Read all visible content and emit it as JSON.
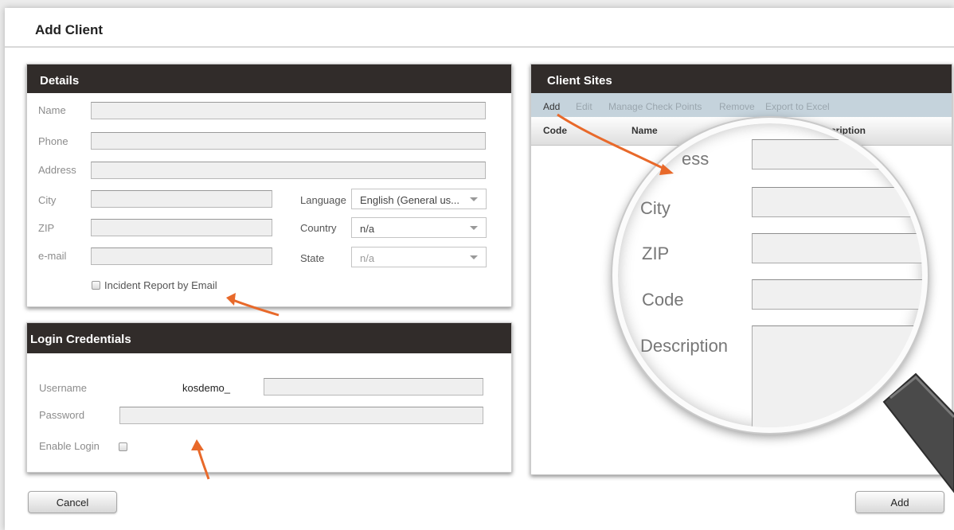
{
  "window": {
    "title": "Add Client"
  },
  "details": {
    "title": "Details",
    "fields": {
      "name": {
        "label": "Name",
        "value": ""
      },
      "phone": {
        "label": "Phone",
        "value": ""
      },
      "address": {
        "label": "Address",
        "value": ""
      },
      "city": {
        "label": "City",
        "value": ""
      },
      "zip": {
        "label": "ZIP",
        "value": ""
      },
      "email": {
        "label": "e-mail",
        "value": ""
      }
    },
    "language": {
      "label": "Language",
      "selected": "English (General us..."
    },
    "country": {
      "label": "Country",
      "selected": "n/a"
    },
    "state": {
      "label": "State",
      "selected": "n/a"
    },
    "incident_report": {
      "label": "Incident Report by Email",
      "checked": false
    }
  },
  "login": {
    "title": "Login Credentials",
    "username": {
      "label": "Username",
      "prefix": "kosdemo_",
      "value": ""
    },
    "password": {
      "label": "Password",
      "value": ""
    },
    "enable_login": {
      "label": "Enable Login",
      "checked": false
    }
  },
  "client_sites": {
    "title": "Client Sites",
    "toolbar": [
      "Add",
      "Edit",
      "Manage Check Points",
      "Remove",
      "Export to Excel"
    ],
    "columns": [
      "Code",
      "Name",
      "cription"
    ]
  },
  "magnifier": {
    "labels": [
      "ess",
      "City",
      "ZIP",
      "Code",
      "Description"
    ]
  },
  "buttons": {
    "cancel": "Cancel",
    "add": "Add"
  },
  "colors": {
    "panel_header": "#312c2a",
    "toolbar": "#c5d3dc",
    "annotation_arrow": "#e8692a"
  }
}
